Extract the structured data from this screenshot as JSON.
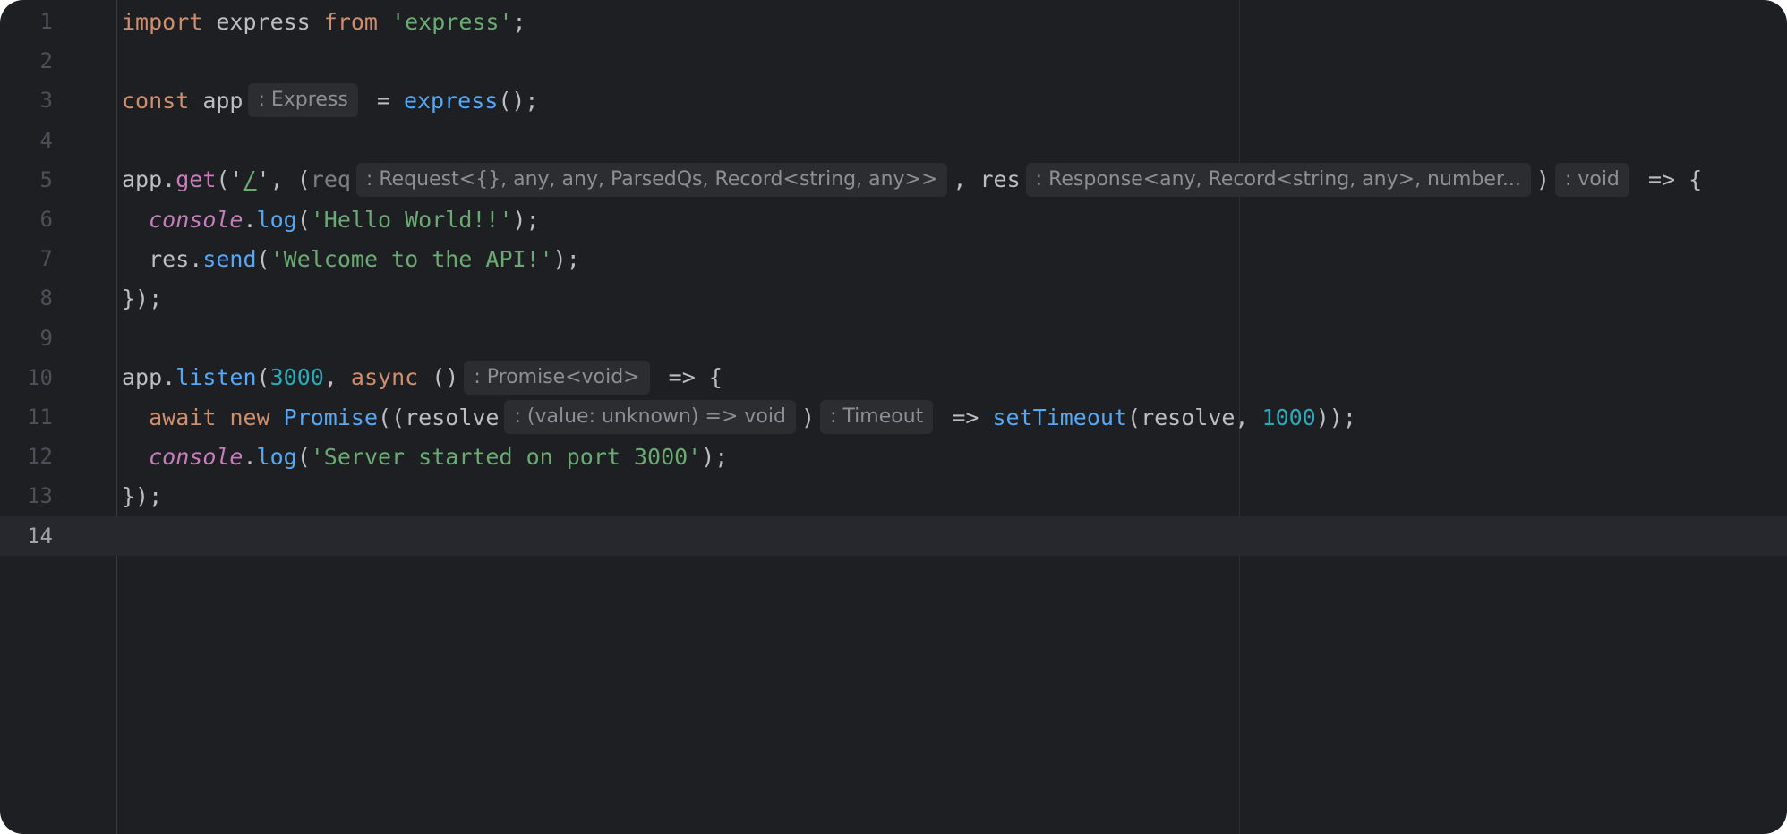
{
  "editor": {
    "lines": [
      {
        "num": "1",
        "tokens": [
          {
            "t": "import",
            "c": "kw"
          },
          {
            "t": " express ",
            "c": "def"
          },
          {
            "t": "from",
            "c": "kw"
          },
          {
            "t": " ",
            "c": "def"
          },
          {
            "t": "'express'",
            "c": "str"
          },
          {
            "t": ";",
            "c": "def"
          }
        ]
      },
      {
        "num": "2",
        "tokens": []
      },
      {
        "num": "3",
        "tokens": [
          {
            "t": "const",
            "c": "kw"
          },
          {
            "t": " app",
            "c": "def"
          },
          {
            "h": ": Express"
          },
          {
            "t": " = ",
            "c": "def"
          },
          {
            "t": "express",
            "c": "fn"
          },
          {
            "t": "();",
            "c": "def"
          }
        ]
      },
      {
        "num": "4",
        "tokens": []
      },
      {
        "num": "5",
        "tokens": [
          {
            "t": "app.",
            "c": "def"
          },
          {
            "t": "get",
            "c": "meth"
          },
          {
            "t": "('",
            "c": "def"
          },
          {
            "t": "/",
            "c": "slash"
          },
          {
            "t": "', (",
            "c": "def"
          },
          {
            "t": "req",
            "c": "dim"
          },
          {
            "h": ": Request<{}, any, any, ParsedQs, Record<string, any>>"
          },
          {
            "t": ", res",
            "c": "def"
          },
          {
            "h": ": Response<any, Record<string, any>, number..."
          },
          {
            "t": ")",
            "c": "def"
          },
          {
            "h": ": void"
          },
          {
            "t": " => {",
            "c": "def"
          }
        ]
      },
      {
        "num": "6",
        "tokens": [
          {
            "t": "  ",
            "c": "def"
          },
          {
            "t": "console",
            "c": "glob"
          },
          {
            "t": ".",
            "c": "def"
          },
          {
            "t": "log",
            "c": "fn"
          },
          {
            "t": "(",
            "c": "def"
          },
          {
            "t": "'Hello World!!'",
            "c": "str"
          },
          {
            "t": ");",
            "c": "def"
          }
        ]
      },
      {
        "num": "7",
        "tokens": [
          {
            "t": "  res.",
            "c": "def"
          },
          {
            "t": "send",
            "c": "fn"
          },
          {
            "t": "(",
            "c": "def"
          },
          {
            "t": "'Welcome to the API!'",
            "c": "str"
          },
          {
            "t": ");",
            "c": "def"
          }
        ]
      },
      {
        "num": "8",
        "tokens": [
          {
            "t": "});",
            "c": "def"
          }
        ]
      },
      {
        "num": "9",
        "tokens": []
      },
      {
        "num": "10",
        "tokens": [
          {
            "t": "app.",
            "c": "def"
          },
          {
            "t": "listen",
            "c": "fn"
          },
          {
            "t": "(",
            "c": "def"
          },
          {
            "t": "3000",
            "c": "num"
          },
          {
            "t": ", ",
            "c": "def"
          },
          {
            "t": "async",
            "c": "kw"
          },
          {
            "t": " ()",
            "c": "def"
          },
          {
            "h": ": Promise<void>"
          },
          {
            "t": " => {",
            "c": "def"
          }
        ]
      },
      {
        "num": "11",
        "tokens": [
          {
            "t": "  ",
            "c": "def"
          },
          {
            "t": "await",
            "c": "kw"
          },
          {
            "t": " ",
            "c": "def"
          },
          {
            "t": "new",
            "c": "kw"
          },
          {
            "t": " ",
            "c": "def"
          },
          {
            "t": "Promise",
            "c": "fn"
          },
          {
            "t": "((resolve",
            "c": "def"
          },
          {
            "h": ": (value: unknown) => void"
          },
          {
            "t": ")",
            "c": "def"
          },
          {
            "h": ": Timeout"
          },
          {
            "t": " => ",
            "c": "def"
          },
          {
            "t": "setTimeout",
            "c": "fn"
          },
          {
            "t": "(resolve, ",
            "c": "def"
          },
          {
            "t": "1000",
            "c": "num"
          },
          {
            "t": "));",
            "c": "def"
          }
        ]
      },
      {
        "num": "12",
        "tokens": [
          {
            "t": "  ",
            "c": "def"
          },
          {
            "t": "console",
            "c": "glob"
          },
          {
            "t": ".",
            "c": "def"
          },
          {
            "t": "log",
            "c": "fn"
          },
          {
            "t": "(",
            "c": "def"
          },
          {
            "t": "'Server started on port 3000'",
            "c": "str"
          },
          {
            "t": ");",
            "c": "def"
          }
        ]
      },
      {
        "num": "13",
        "tokens": [
          {
            "t": "});",
            "c": "def"
          }
        ]
      },
      {
        "num": "14",
        "tokens": [],
        "current": true
      }
    ]
  }
}
